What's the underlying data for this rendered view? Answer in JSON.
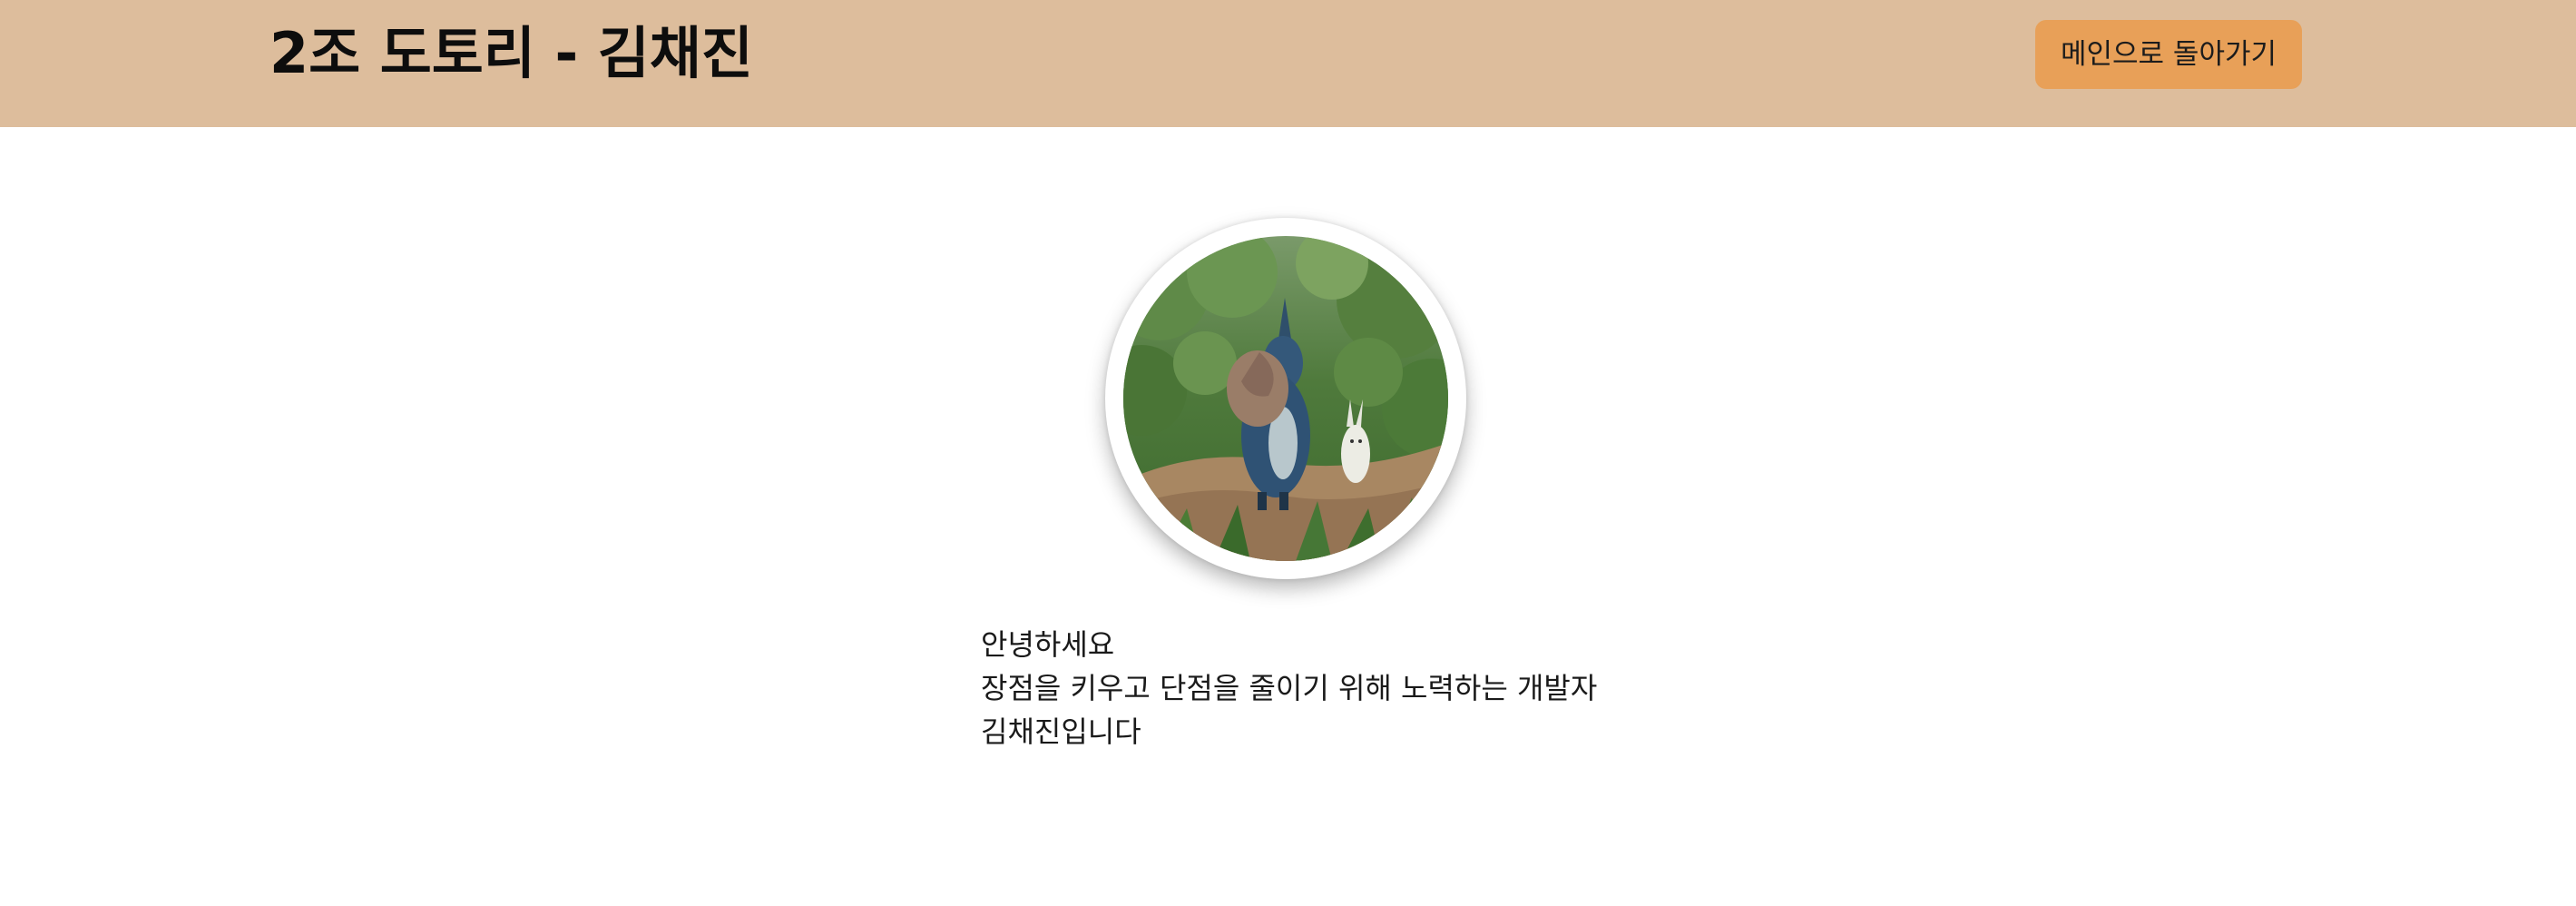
{
  "header": {
    "title": "2조 도토리 - 김채진",
    "back_button_label": "메인으로 돌아가기"
  },
  "profile": {
    "image_icon": "profile-illustration-icon",
    "intro_lines": [
      "안녕하세요",
      "장점을 키우고 단점을 줄이기 위해 노력하는 개발자",
      "김채진입니다"
    ]
  },
  "colors": {
    "header_background": "#ddbd9c",
    "button_background": "#e8a058",
    "page_background": "#ffffff"
  }
}
